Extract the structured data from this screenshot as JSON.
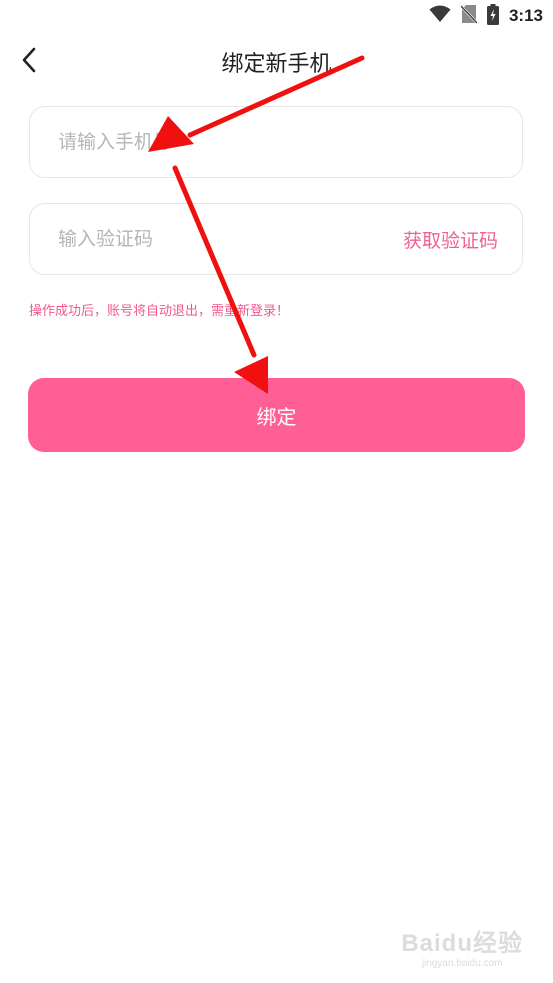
{
  "status_bar": {
    "time": "3:13",
    "icons": [
      "wifi-icon",
      "no-sim-icon",
      "battery-charging-icon"
    ]
  },
  "header": {
    "title": "绑定新手机",
    "back_icon": "chevron-left-icon"
  },
  "form": {
    "phone": {
      "placeholder": "请输入手机号",
      "value": ""
    },
    "code": {
      "placeholder": "输入验证码",
      "value": "",
      "get_code_label": "获取验证码"
    },
    "notice": "操作成功后，账号将自动退出，需重新登录！",
    "submit_label": "绑定"
  },
  "colors": {
    "accent": "#ff5f94",
    "accent_text": "#f06292",
    "annotation_arrow": "#f01010"
  },
  "watermark": {
    "logo": "Baidu经验",
    "url": "jingyan.baidu.com"
  }
}
